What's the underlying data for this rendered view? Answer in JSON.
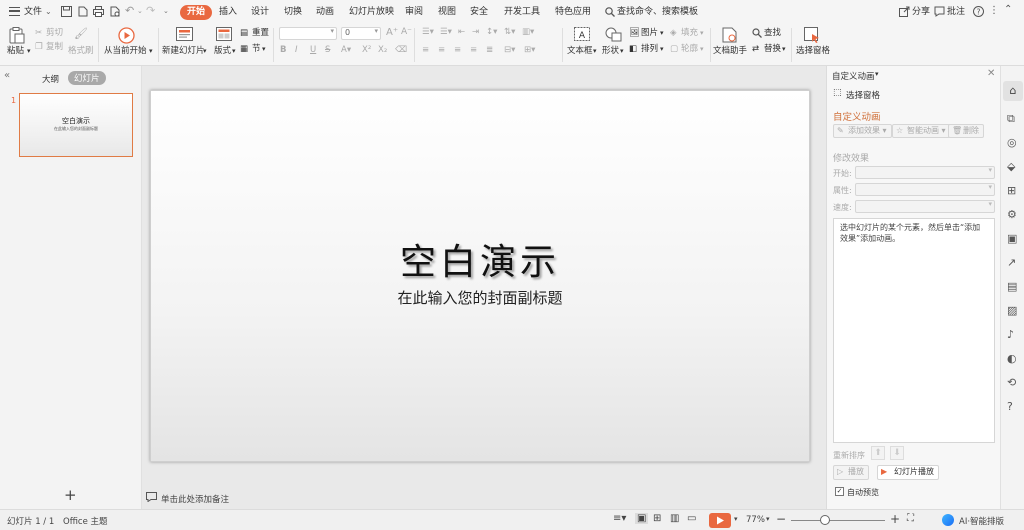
{
  "menubar": {
    "file_label": "文件",
    "tabs": [
      "开始",
      "插入",
      "设计",
      "切换",
      "动画",
      "幻灯片放映",
      "审阅",
      "视图",
      "安全",
      "开发工具",
      "特色应用"
    ],
    "active_tab": "开始",
    "search_placeholder": "查找命令、搜索模板",
    "share_label": "分享",
    "comment_label": "批注"
  },
  "ribbon": {
    "paste": "粘贴",
    "cut": "剪切",
    "copy": "复制",
    "format_painter": "格式刷",
    "from_current": "从当前开始",
    "new_slide": "新建幻灯片",
    "layout": "版式",
    "reset": "重置",
    "section": "节",
    "font_size": "0",
    "textbox": "文本框",
    "shape": "形状",
    "picture": "图片",
    "fill": "填充",
    "arrange": "排列",
    "outline": "轮廓",
    "doc_assistant": "文档助手",
    "find": "查找",
    "replace": "替换",
    "select_pane": "选择窗格"
  },
  "leftpanel": {
    "tab_outline": "大纲",
    "tab_slides": "幻灯片",
    "thumb_number": "1",
    "thumb_title": "空白演示",
    "thumb_subtitle": "在此输入您的封面副标题"
  },
  "slide": {
    "title": "空白演示",
    "subtitle": "在此输入您的封面副标题"
  },
  "notes_placeholder": "单击此处添加备注",
  "rightpanel": {
    "header": "自定义动画",
    "select_pane": "选择窗格",
    "section_title": "自定义动画",
    "add_effect": "添加效果",
    "smart_anim": "智能动画",
    "delete": "删除",
    "modify_effect": "修改效果",
    "start_label": "开始:",
    "property_label": "属性:",
    "speed_label": "速度:",
    "hint": "选中幻灯片的某个元素，然后单击“添加效果”添加动画。",
    "reorder": "重新排序",
    "play": "播放",
    "slideshow": "幻灯片播放",
    "autopreview": "自动预览"
  },
  "statusbar": {
    "slide_info": "幻灯片 1 / 1",
    "theme": "Office 主题",
    "zoom": "77%",
    "ai_layout": "AI·智能排版"
  },
  "colors": {
    "accent": "#e96840",
    "section_title": "#d0703a"
  }
}
